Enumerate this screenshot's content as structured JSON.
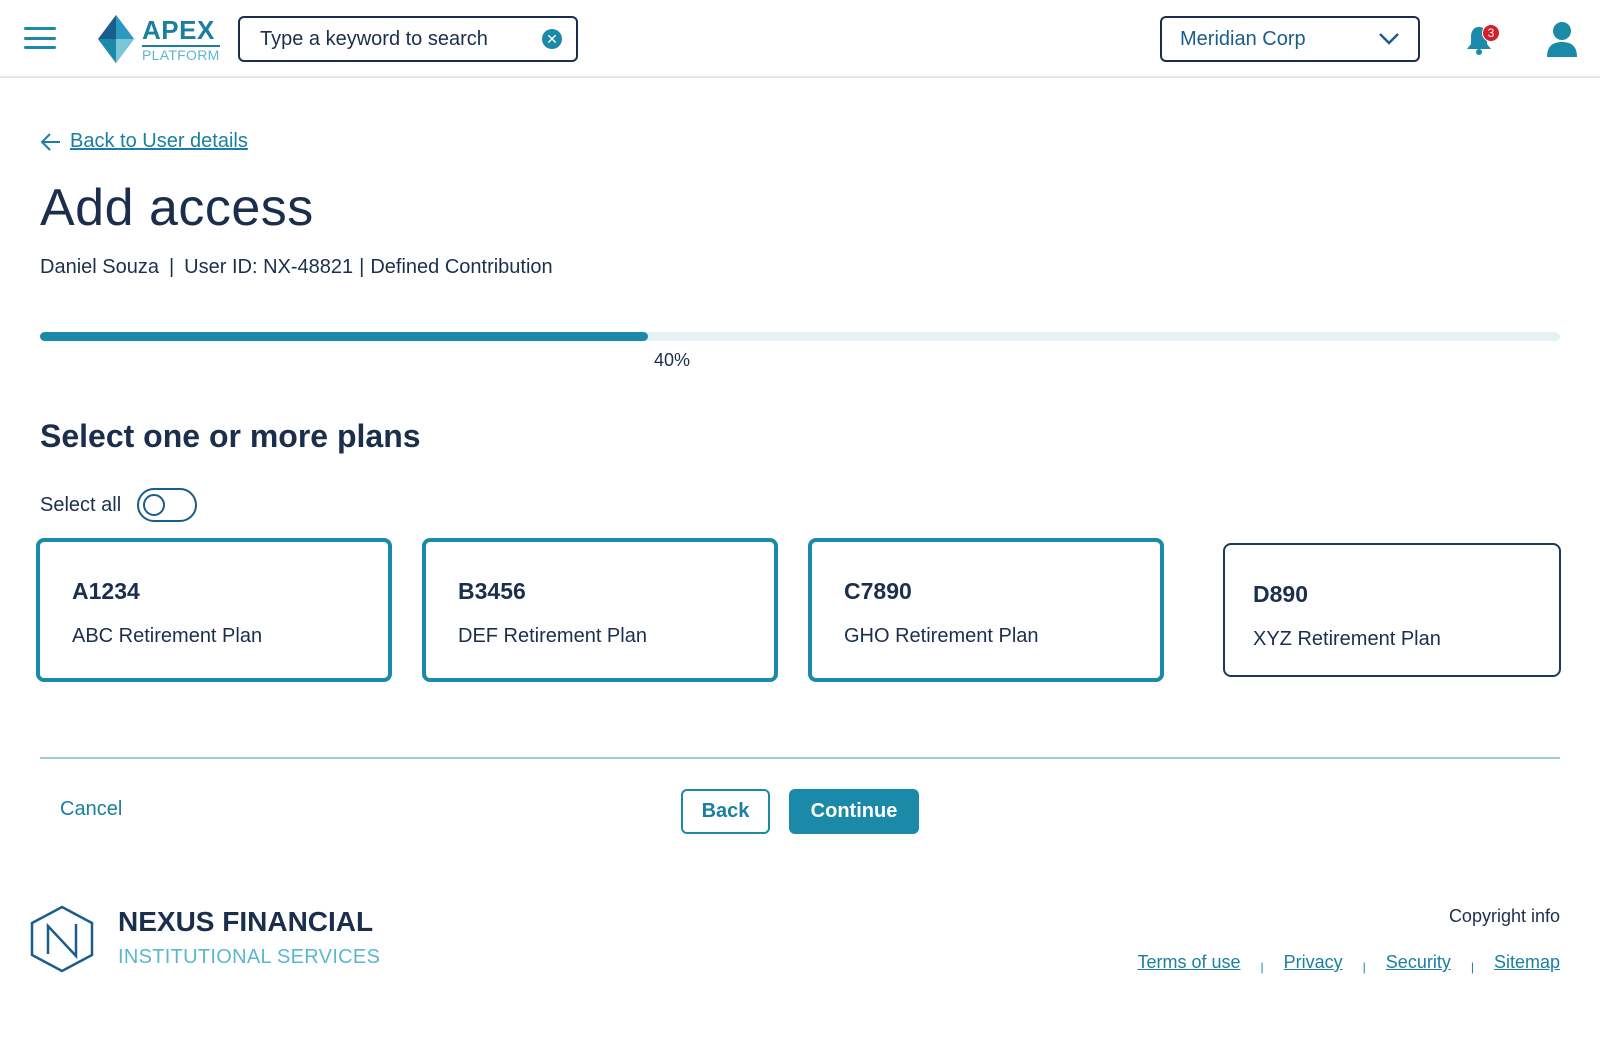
{
  "header": {
    "menu_icon": "hamburger-menu-icon",
    "logo": {
      "name": "APEX",
      "sub": "PLATFORM"
    },
    "search": {
      "value": "Type a keyword to search",
      "clear_icon": "clear-circle-icon"
    },
    "company_selector": {
      "value": "Meridian Corp",
      "icon": "chevron-down-icon"
    },
    "notifications": {
      "count": "3",
      "icon": "bell-icon"
    },
    "user_icon": "user-profile-icon"
  },
  "breadcrumb": {
    "back_label": "Back to User details"
  },
  "page": {
    "title": "Add access",
    "user_name": "Daniel Souza",
    "user_id": "User ID: NX-48821",
    "plan_type": "Defined Contribution"
  },
  "progress": {
    "value": 0.4,
    "label": "40%"
  },
  "plans_section": {
    "title": "Select one or more plans",
    "select_all_label": "Select all",
    "select_all_on": false,
    "plans": [
      {
        "code": "A1234",
        "name": "ABC Retirement Plan",
        "selected": true
      },
      {
        "code": "B3456",
        "name": "DEF Retirement Plan",
        "selected": true
      },
      {
        "code": "C7890",
        "name": "GHO Retirement Plan",
        "selected": true
      },
      {
        "code": "D890",
        "name": "XYZ Retirement Plan",
        "selected": false
      }
    ]
  },
  "actions": {
    "cancel": "Cancel",
    "back": "Back",
    "continue": "Continue"
  },
  "footer": {
    "company_name": "NEXUS FINANCIAL",
    "company_sub": "INSTITUTIONAL SERVICES",
    "copyright": "Copyright info",
    "links": [
      "Terms of use",
      "Privacy",
      "Security",
      "Sitemap"
    ]
  },
  "colors": {
    "primary": "#1b8aa8",
    "text": "#1b2f4d",
    "link": "#1a7fa0",
    "badge": "#d41f2a",
    "progress_track": "#e6f1f6"
  }
}
